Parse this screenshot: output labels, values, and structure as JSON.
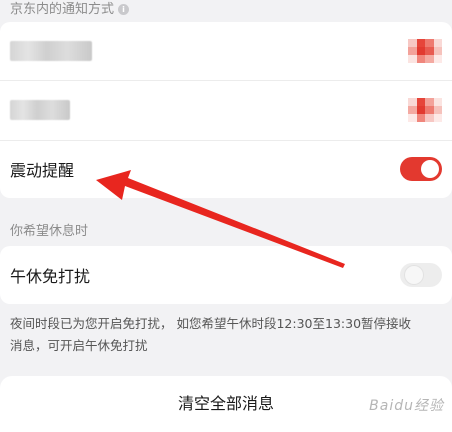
{
  "notify_section": {
    "title": "京东内的通知方式",
    "info_icon": "info-icon"
  },
  "notify_rows": [
    {
      "name": "blurred-setting-1"
    },
    {
      "name": "blurred-setting-2"
    },
    {
      "label": "震动提醒",
      "toggle_on": true
    }
  ],
  "rest_section": {
    "title": "你希望休息时",
    "row": {
      "label": "午休免打扰",
      "toggle_on": false
    }
  },
  "note": {
    "line1": "夜间时段已为您开启免打扰， 如您希望午休时段12:30至13:30暂停接收",
    "line2": "消息，可开启午休免打扰"
  },
  "clear_button": {
    "label": "清空全部消息"
  },
  "watermark": {
    "text": "Baidu经验"
  },
  "colors": {
    "accent": "#e3392f",
    "background": "#f2f2f4",
    "annotation_arrow": "#e8261f"
  }
}
